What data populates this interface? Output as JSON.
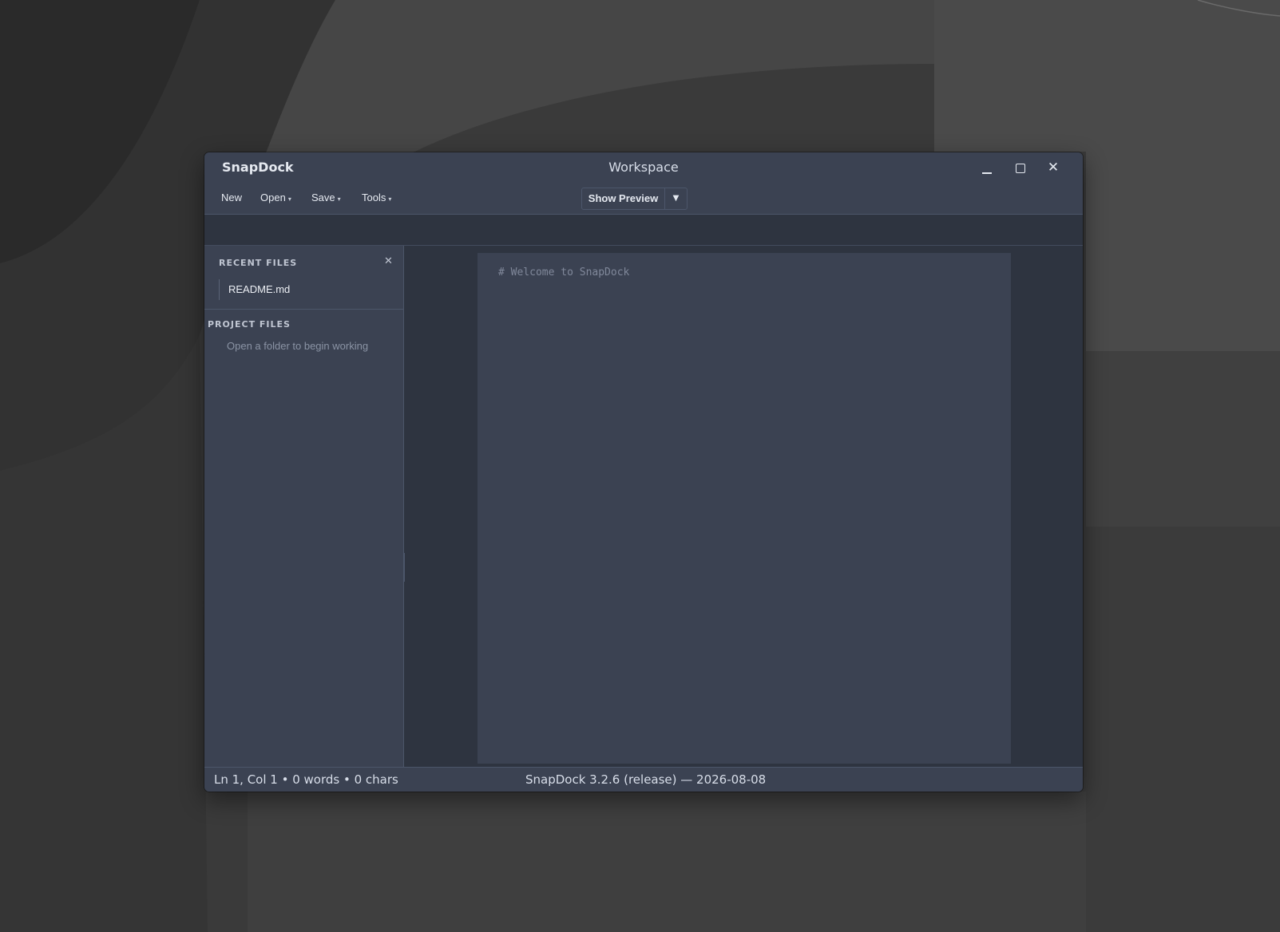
{
  "window": {
    "app_name": "SnapDock",
    "title": "Workspace",
    "controls": {
      "minimize": "",
      "maximize": "",
      "close": "✕"
    }
  },
  "toolbar": {
    "new_label": "New",
    "open_label": "Open",
    "save_label": "Save",
    "tools_label": "Tools",
    "caret": "▾",
    "show_preview_label": "Show Preview",
    "preview_dropdown": "▼"
  },
  "sidebar": {
    "recent_files_title": "RECENT FILES",
    "recent_close": "✕",
    "recent_files": [
      "README.md"
    ],
    "project_files_title": "PROJECT FILES",
    "project_empty_text": "Open a folder to begin working"
  },
  "editor": {
    "content": "# Welcome to SnapDock"
  },
  "status": {
    "position": "Ln 1, Col 1 • 0 words • 0 chars",
    "version": "SnapDock 3.2.6 (release) — 2026-08-08"
  },
  "colors": {
    "window_bg": "#2e3440",
    "panel_bg": "#3b4252",
    "border": "#4c566a",
    "text": "#e5e9f0"
  }
}
